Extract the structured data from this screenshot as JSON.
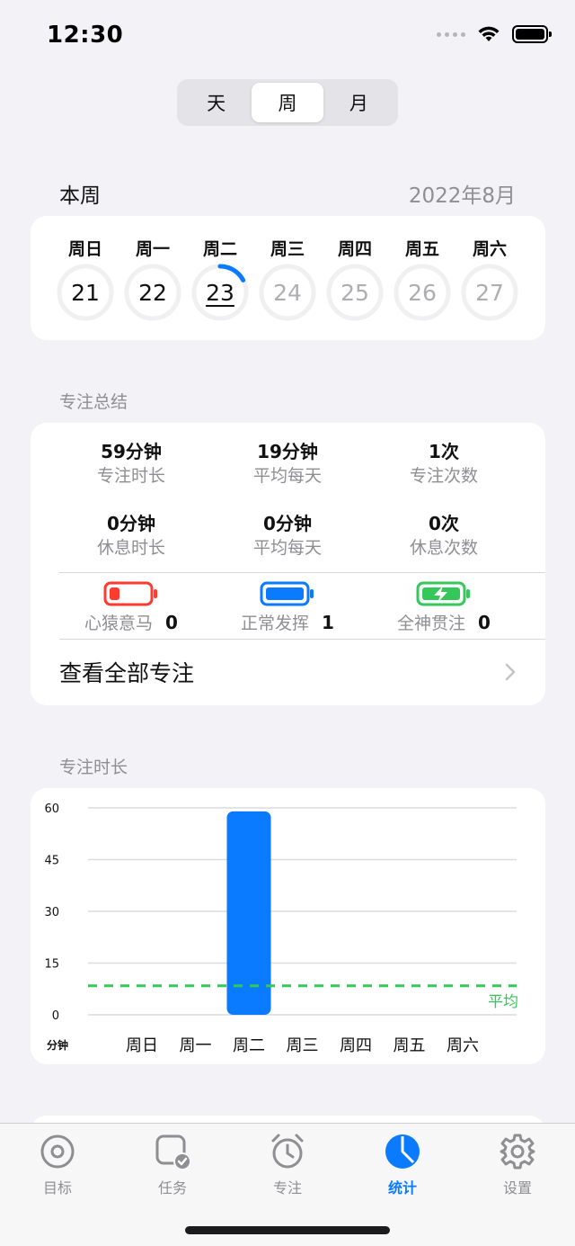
{
  "status_bar": {
    "time": "12:30"
  },
  "segmented": {
    "items": [
      "天",
      "周",
      "月"
    ],
    "selected": "周"
  },
  "week": {
    "title": "本周",
    "month": "2022年8月",
    "days": [
      {
        "label": "周日",
        "date": "21",
        "state": "past"
      },
      {
        "label": "周一",
        "date": "22",
        "state": "past"
      },
      {
        "label": "周二",
        "date": "23",
        "state": "today"
      },
      {
        "label": "周三",
        "date": "24",
        "state": "future"
      },
      {
        "label": "周四",
        "date": "25",
        "state": "future"
      },
      {
        "label": "周五",
        "date": "26",
        "state": "future"
      },
      {
        "label": "周六",
        "date": "27",
        "state": "future"
      }
    ]
  },
  "summary": {
    "section_label": "专注总结",
    "rows": [
      [
        {
          "value": "59分钟",
          "label": "专注时长"
        },
        {
          "value": "19分钟",
          "label": "平均每天"
        },
        {
          "value": "1次",
          "label": "专注次数"
        }
      ],
      [
        {
          "value": "0分钟",
          "label": "休息时长"
        },
        {
          "value": "0分钟",
          "label": "平均每天"
        },
        {
          "value": "0次",
          "label": "休息次数"
        }
      ]
    ],
    "moods": [
      {
        "name": "心猿意马",
        "count": "0",
        "icon": "battery-low-icon",
        "color": "#ff3b30"
      },
      {
        "name": "正常发挥",
        "count": "1",
        "icon": "battery-full-icon",
        "color": "#0a7aff"
      },
      {
        "name": "全神贯注",
        "count": "0",
        "icon": "battery-charging-icon",
        "color": "#34c759"
      }
    ],
    "view_all": "查看全部专注"
  },
  "chart_data": {
    "type": "bar",
    "title": "专注时长",
    "ylabel": "分钟",
    "categories": [
      "周日",
      "周一",
      "周二",
      "周三",
      "周四",
      "周五",
      "周六"
    ],
    "values": [
      0,
      0,
      59,
      0,
      0,
      0,
      0
    ],
    "ylim": [
      0,
      60
    ],
    "yticks": [
      0,
      15,
      30,
      45,
      60
    ],
    "average": {
      "value": 8.4,
      "label": "平均",
      "color": "#34c759"
    },
    "bar_color": "#0a7aff",
    "grid": true
  },
  "tabs": [
    {
      "label": "目标",
      "icon": "target-icon",
      "active": false
    },
    {
      "label": "任务",
      "icon": "task-check-icon",
      "active": false
    },
    {
      "label": "专注",
      "icon": "alarm-clock-icon",
      "active": false
    },
    {
      "label": "统计",
      "icon": "pie-chart-icon",
      "active": true
    },
    {
      "label": "设置",
      "icon": "gear-icon",
      "active": false
    }
  ]
}
